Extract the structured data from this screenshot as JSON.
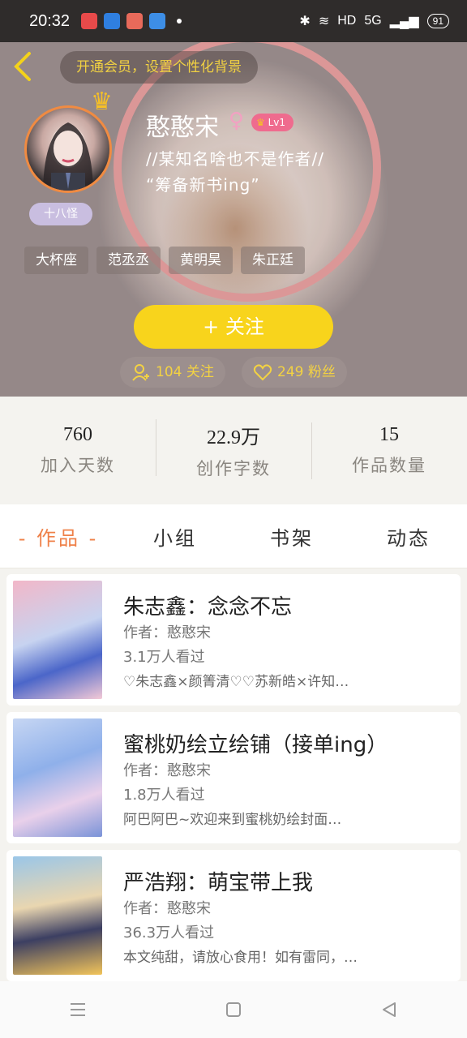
{
  "status_bar": {
    "time": "20:32",
    "network": "HD",
    "signal": "5G",
    "battery": "91"
  },
  "header": {
    "back_icon": "chevron-left-icon",
    "vip_banner": "开通会员，设置个性化背景"
  },
  "profile": {
    "username": "憨憨宋",
    "gender_symbol": "♀",
    "level": "Lv1",
    "bio_line1": "//某知名啥也不是作者//",
    "bio_line2": "“筹备新书ing”",
    "badge": "十八怪",
    "tags": [
      "大杯座",
      "范丞丞",
      "黄明昊",
      "朱正廷"
    ],
    "follow_button": "+ 关注",
    "following": "104 关注",
    "followers": "249 粉丝"
  },
  "stats": [
    {
      "value": "760",
      "label": "加入天数"
    },
    {
      "value": "22.9万",
      "label": "创作字数"
    },
    {
      "value": "15",
      "label": "作品数量"
    }
  ],
  "tabs": [
    {
      "label": "- 作品 -",
      "active": true
    },
    {
      "label": "小组",
      "active": false
    },
    {
      "label": "书架",
      "active": false
    },
    {
      "label": "动态",
      "active": false
    }
  ],
  "works": [
    {
      "title": "朱志鑫：念念不忘",
      "author": "作者：憨憨宋",
      "views": "3.1万人看过",
      "desc": "♡朱志鑫×颜箐清♡♡苏新皓×许知…"
    },
    {
      "title": "蜜桃奶绘立绘铺（接单ing）",
      "author": "作者：憨憨宋",
      "views": "1.8万人看过",
      "desc": "阿巴阿巴~欢迎来到蜜桃奶绘封面…"
    },
    {
      "title": "严浩翔：萌宝带上我",
      "author": "作者：憨憨宋",
      "views": "36.3万人看过",
      "desc": "本文纯甜，请放心食用！如有雷同，…"
    }
  ],
  "colors": {
    "accent": "#ef8149",
    "follow_button": "#f8d41c",
    "vip_text": "#f1d142"
  }
}
